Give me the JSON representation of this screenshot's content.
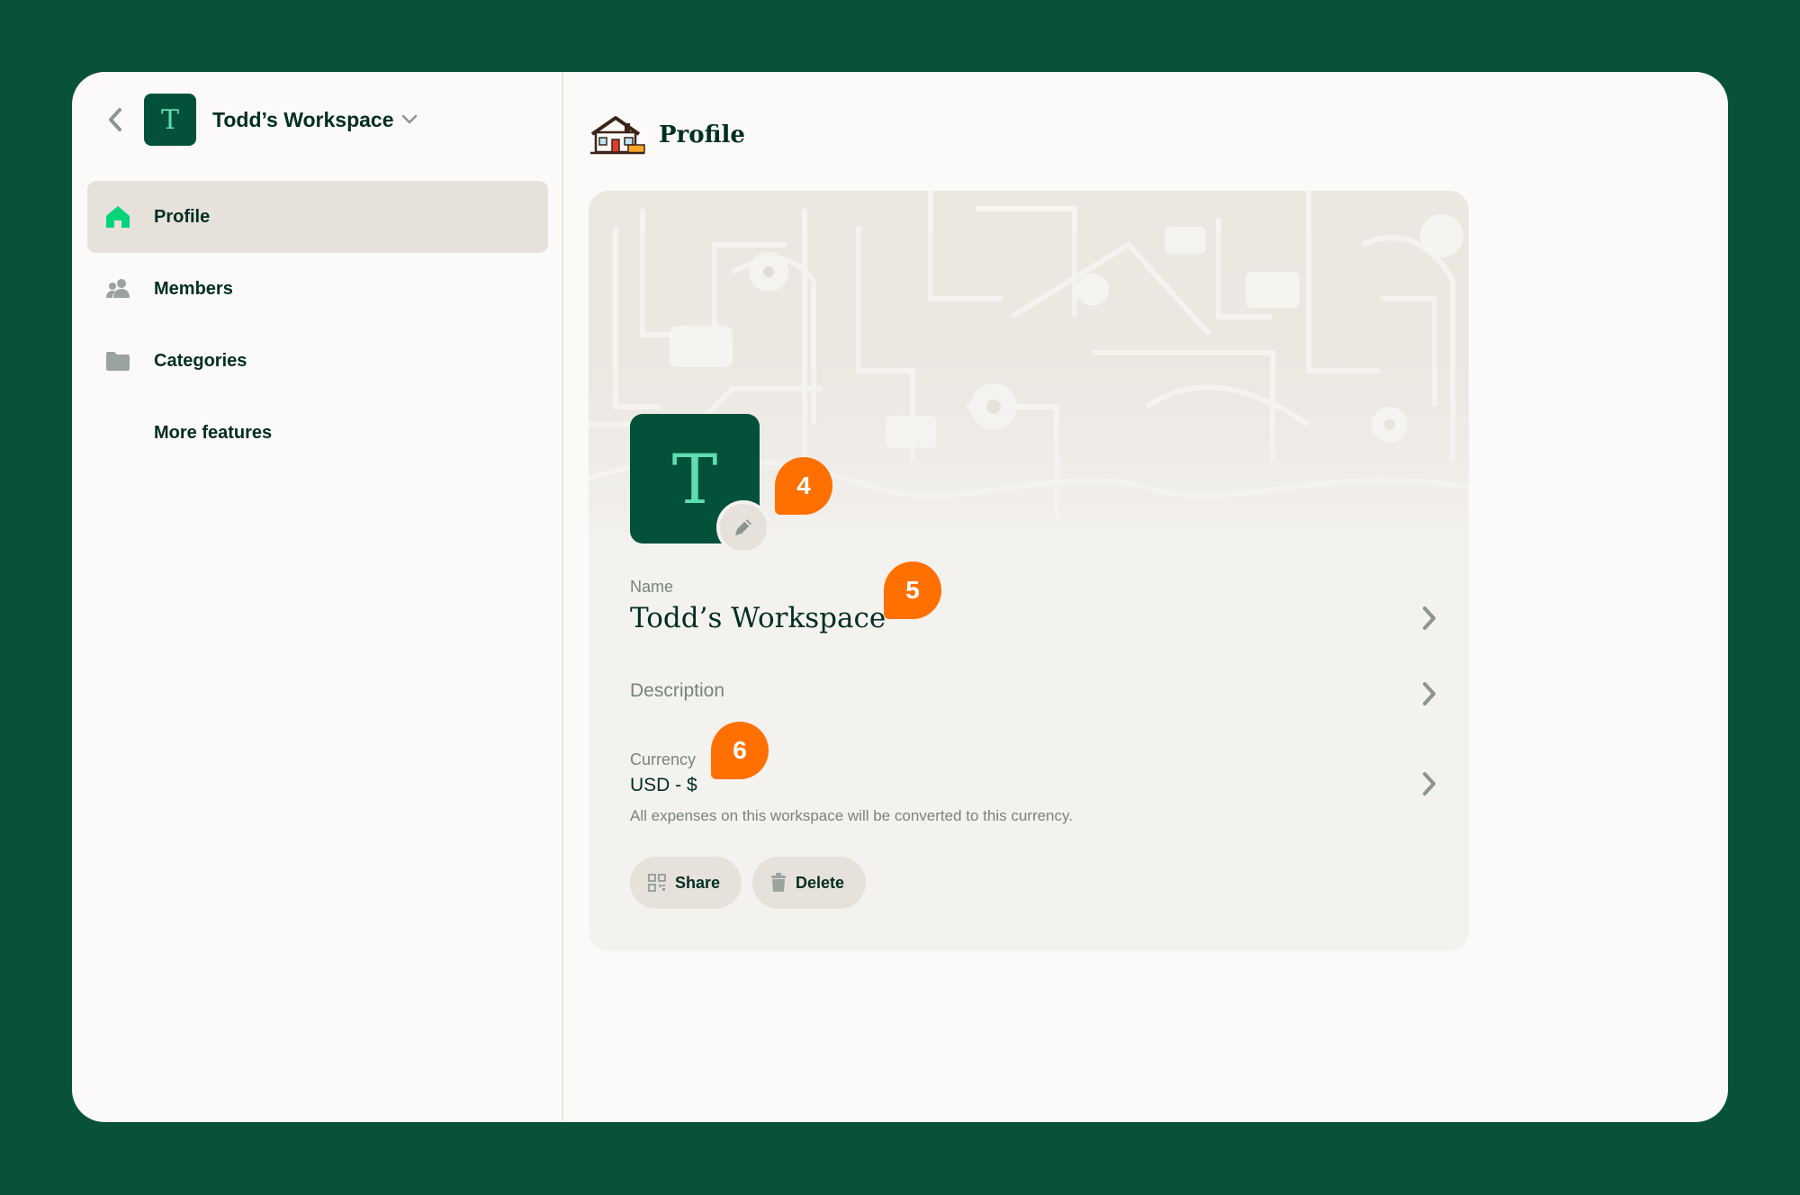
{
  "sidebar": {
    "workspace_initial": "T",
    "workspace_name": "Todd’s Workspace",
    "items": [
      {
        "label": "Profile",
        "icon": "home-icon",
        "active": true
      },
      {
        "label": "Members",
        "icon": "members-icon",
        "active": false
      },
      {
        "label": "Categories",
        "icon": "folder-icon",
        "active": false
      },
      {
        "label": "More features",
        "icon": "",
        "active": false
      }
    ]
  },
  "header": {
    "title": "Profile",
    "icon": "house-illustration-icon"
  },
  "profile": {
    "avatar_initial": "T",
    "name_label": "Name",
    "name_value": "Todd’s Workspace",
    "description_label": "Description",
    "currency_label": "Currency",
    "currency_value": "USD - $",
    "currency_hint": "All expenses on this workspace will be converted to this currency.",
    "share_label": "Share",
    "delete_label": "Delete"
  },
  "markers": [
    "4",
    "5",
    "6"
  ],
  "colors": {
    "background": "#08523a",
    "brand_dark": "#03513b",
    "brand_accent": "#5fdeb0",
    "active_green": "#03d47c",
    "marker": "#ff7000",
    "card": "#f4f2ef",
    "pill": "#e6e1da"
  }
}
